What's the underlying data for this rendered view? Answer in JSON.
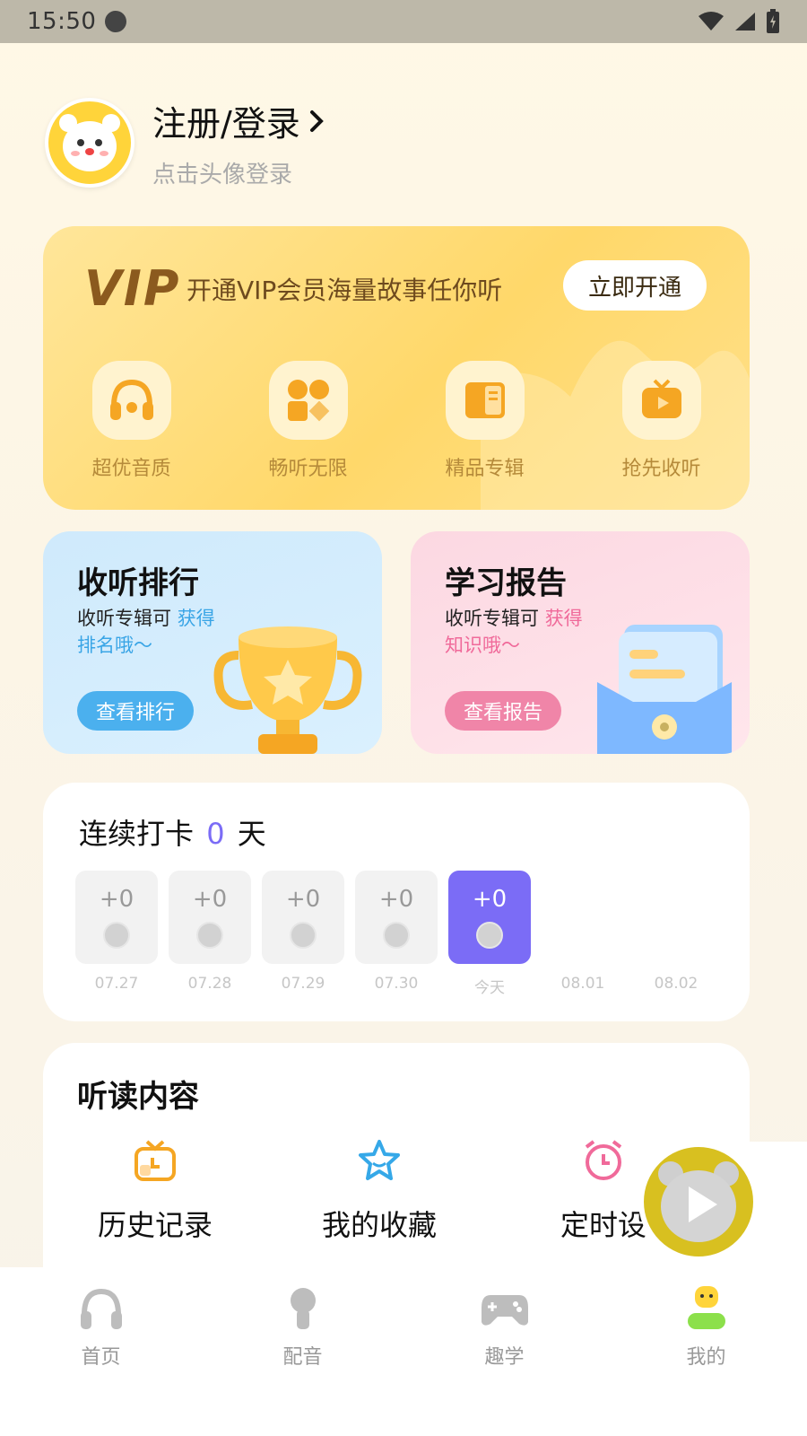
{
  "status_bar": {
    "time": "15:50"
  },
  "profile": {
    "title": "注册/登录",
    "subtitle": "点击头像登录"
  },
  "vip": {
    "logo": "VIP",
    "slogan": "开通VIP会员海量故事任你听",
    "button": "立即开通",
    "perks": [
      {
        "label": "超优音质",
        "icon": "headphones-icon"
      },
      {
        "label": "畅听无限",
        "icon": "shapes-icon"
      },
      {
        "label": "精品专辑",
        "icon": "book-icon"
      },
      {
        "label": "抢先收听",
        "icon": "tv-play-icon"
      }
    ]
  },
  "rank_card": {
    "title": "收听排行",
    "desc": "收听专辑可 ",
    "highlight": "获得",
    "desc2": "排名哦～",
    "button": "查看排行"
  },
  "report_card": {
    "title": "学习报告",
    "desc": "收听专辑可 ",
    "highlight": "获得",
    "desc2": "知识哦～",
    "button": "查看报告"
  },
  "checkin": {
    "prefix": "连续打卡",
    "count": "0",
    "suffix": "天",
    "days": [
      {
        "points": "+0",
        "date": "07.27"
      },
      {
        "points": "+0",
        "date": "07.28"
      },
      {
        "points": "+0",
        "date": "07.29"
      },
      {
        "points": "+0",
        "date": "07.30"
      },
      {
        "points": "+0",
        "date": "今天"
      },
      {
        "points": "",
        "date": "08.01"
      },
      {
        "points": "",
        "date": "08.02"
      }
    ]
  },
  "content": {
    "title": "听读内容",
    "items": [
      {
        "label": "历史记录",
        "icon": "history-tv-icon"
      },
      {
        "label": "我的收藏",
        "icon": "star-icon"
      },
      {
        "label": "定时设",
        "icon": "alarm-clock-icon"
      }
    ]
  },
  "tabs": [
    {
      "label": "首页",
      "icon": "headphones-icon"
    },
    {
      "label": "配音",
      "icon": "microphone-icon"
    },
    {
      "label": "趣学",
      "icon": "gamepad-icon"
    },
    {
      "label": "我的",
      "icon": "profile-icon"
    }
  ],
  "colors": {
    "accent": "#7B6CF6",
    "vip": "#FFD86A",
    "rank": "#4BB0EE",
    "report": "#F085A8",
    "avatar": "#FFD43A"
  }
}
